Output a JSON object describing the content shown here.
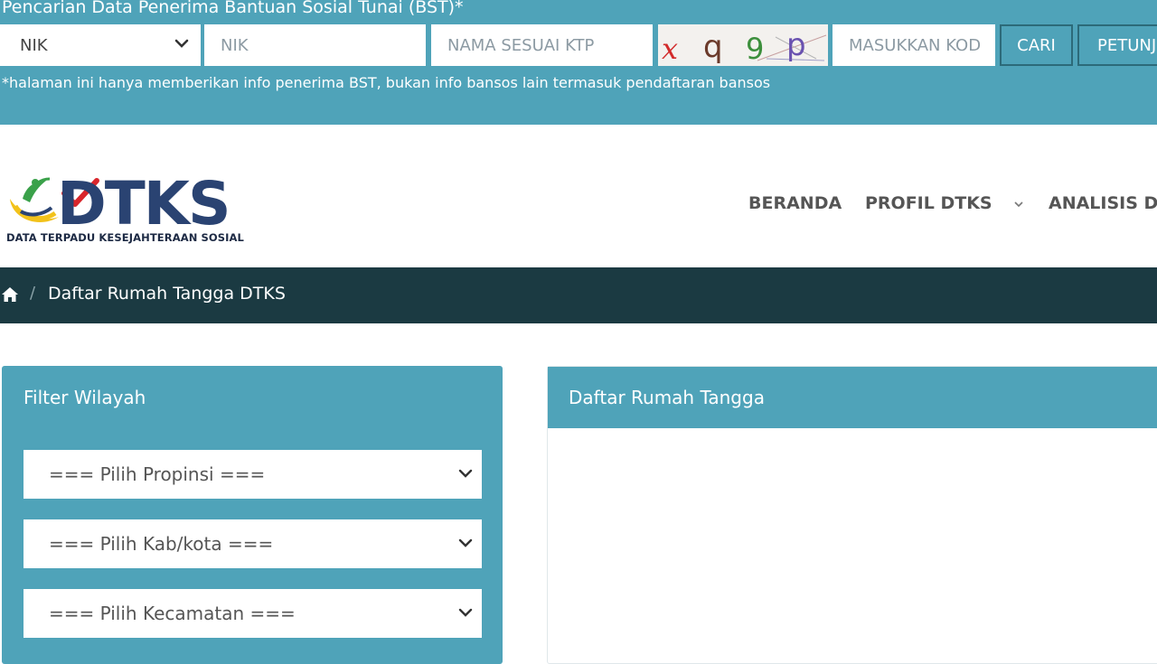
{
  "bst": {
    "title": "Pencarian Data Penerima Bantuan Sosial Tunai (BST)*",
    "nik_select_value": "NIK",
    "nik_placeholder": "NIK",
    "nama_placeholder": "NAMA SESUAI KTP",
    "captcha_text": "xq9p",
    "kode_placeholder": "MASUKKAN KOD",
    "cari_label": "CARI",
    "petunjuk_label": "PETUNJ",
    "note": "*halaman ini hanya memberikan info penerima BST, bukan info bansos lain termasuk pendaftaran bansos"
  },
  "header": {
    "logo_text": "DTKS",
    "logo_subtitle": "DATA TERPADU KESEJAHTERAAN SOSIAL",
    "nav": {
      "beranda": "BERANDA",
      "profil": "PROFIL DTKS",
      "analisis": "ANALISIS DA"
    }
  },
  "breadcrumb": {
    "separator": "/",
    "current": "Daftar Rumah Tangga DTKS"
  },
  "filter": {
    "title": "Filter Wilayah",
    "propinsi": "=== Pilih Propinsi ===",
    "kabkota": "=== Pilih Kab/kota ===",
    "kecamatan": "=== Pilih Kecamatan ==="
  },
  "list": {
    "title": "Daftar Rumah Tangga"
  },
  "colors": {
    "accent": "#4fa3b9",
    "dark_bar": "#1b3a42",
    "logo_navy": "#2a4372"
  },
  "icons": [
    "chevron-down-icon",
    "home-icon"
  ]
}
